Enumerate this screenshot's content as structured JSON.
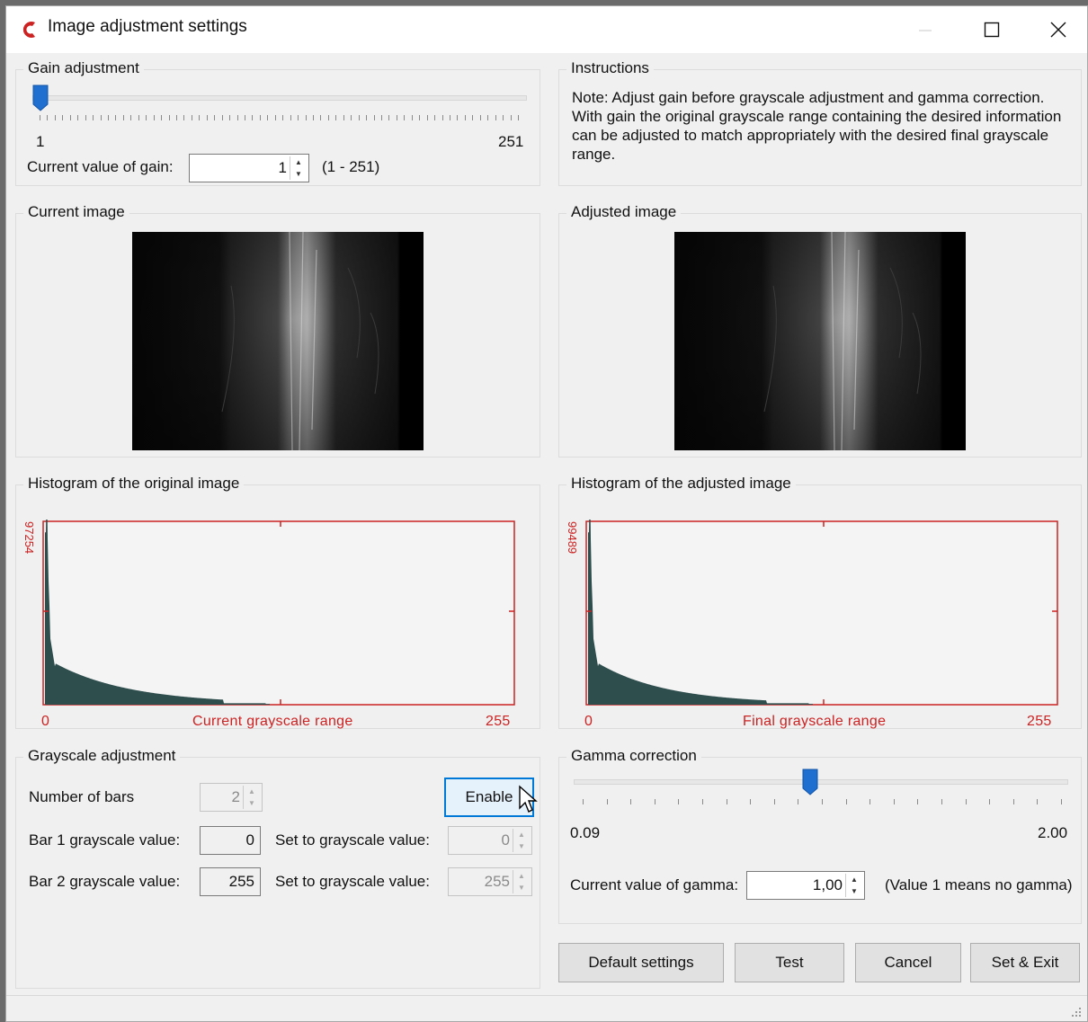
{
  "window": {
    "title": "Image adjustment settings",
    "minimize_icon": "minimize-icon",
    "maximize_icon": "maximize-icon",
    "close_icon": "close-icon",
    "app_icon": "app-logo-icon",
    "accent_color": "#cc2222"
  },
  "gain": {
    "group_label": "Gain adjustment",
    "min_label": "1",
    "max_label": "251",
    "current_label": "Current value of gain:",
    "value": "1",
    "range_text": "(1 - 251)",
    "slider_fraction": 0.0
  },
  "instructions": {
    "group_label": "Instructions",
    "text": "Note: Adjust gain before grayscale adjustment and gamma correction. With gain the original grayscale range containing the desired information can be adjusted to match appropriately with the desired final grayscale range."
  },
  "current_image": {
    "group_label": "Current image"
  },
  "adjusted_image": {
    "group_label": "Adjusted image"
  },
  "histogram_original": {
    "group_label": "Histogram of the original image",
    "y_max_label": "97254",
    "x_min_label": "0",
    "x_title": "Current grayscale range",
    "x_max_label": "255",
    "fill_color": "#2e4d4d",
    "line_color": "#cc2222"
  },
  "histogram_adjusted": {
    "group_label": "Histogram of the adjusted image",
    "y_max_label": "99489",
    "x_min_label": "0",
    "x_title": "Final grayscale range",
    "x_max_label": "255",
    "fill_color": "#2e4d4d",
    "line_color": "#cc2222"
  },
  "grayscale": {
    "group_label": "Grayscale adjustment",
    "bars_label": "Number of bars",
    "bars_value": "2",
    "enable_label": "Enable",
    "bar1_label": "Bar 1 grayscale value:",
    "bar1_value": "0",
    "bar1_set_label": "Set to grayscale value:",
    "bar1_set_value": "0",
    "bar2_label": "Bar 2 grayscale value:",
    "bar2_value": "255",
    "bar2_set_label": "Set to grayscale value:",
    "bar2_set_value": "255"
  },
  "gamma": {
    "group_label": "Gamma correction",
    "min_label": "0.09",
    "max_label": "2.00",
    "current_label": "Current value of gamma:",
    "value": "1,00",
    "note": "(Value 1 means no gamma)",
    "slider_fraction": 0.48
  },
  "buttons": {
    "default": "Default settings",
    "test": "Test",
    "cancel": "Cancel",
    "set_exit": "Set & Exit"
  }
}
